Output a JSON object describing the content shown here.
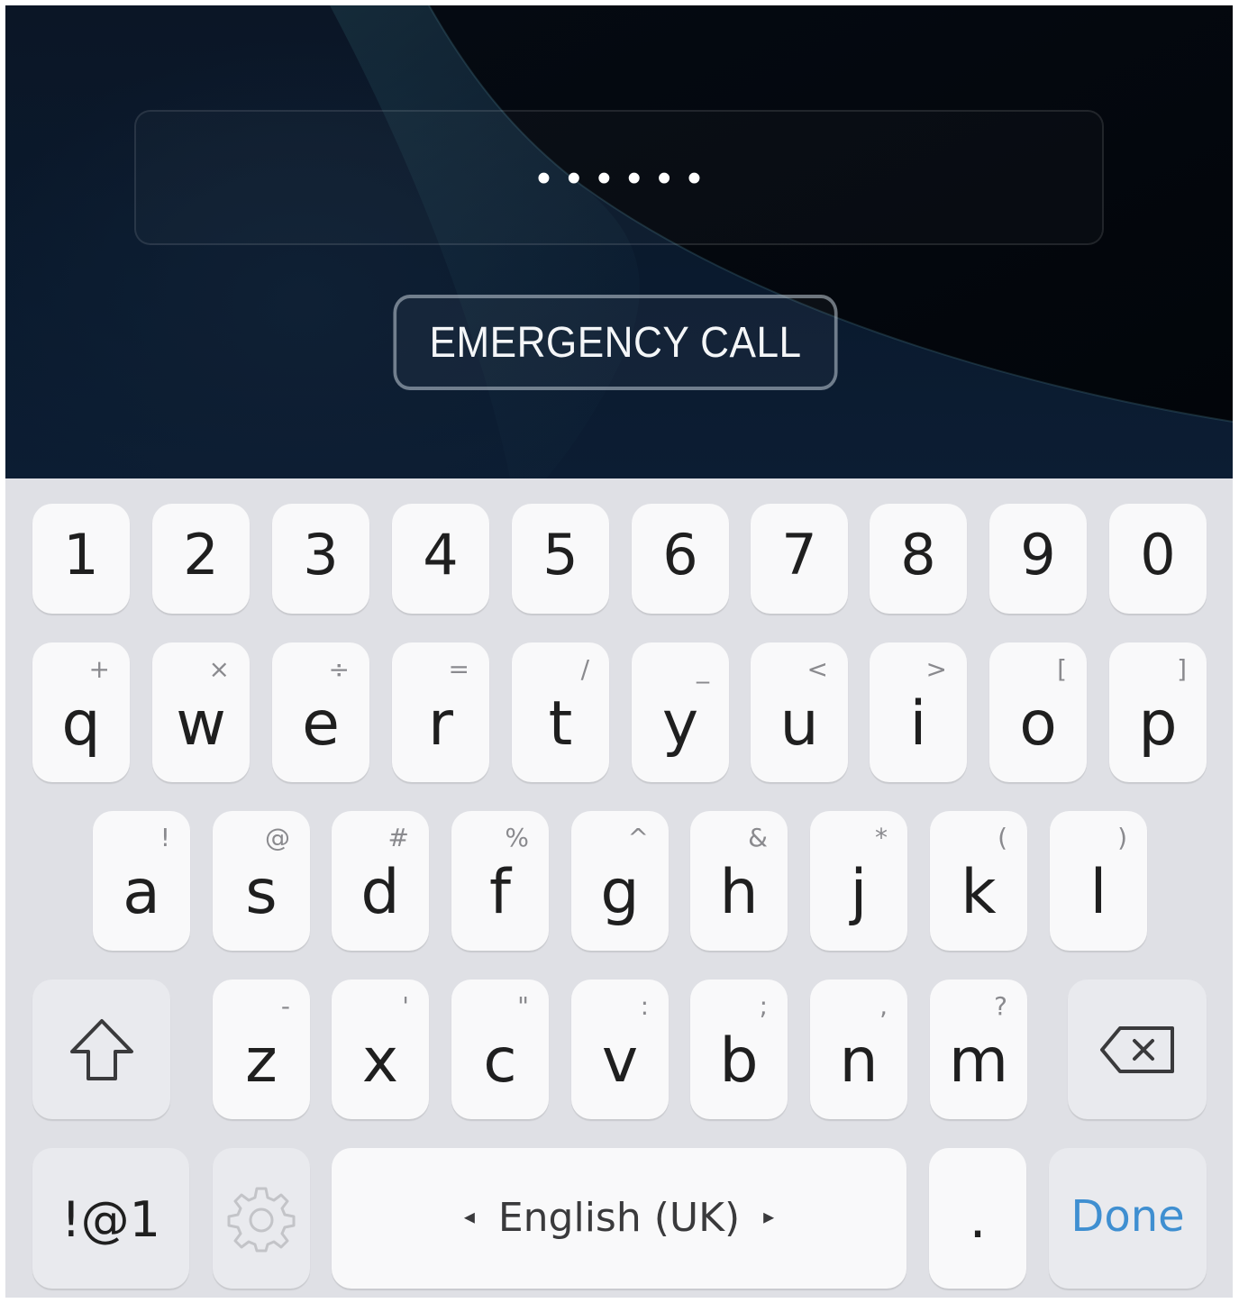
{
  "lock_screen": {
    "password_mask": "••••••",
    "emergency_label": "EMERGENCY CALL"
  },
  "keyboard": {
    "number_row": [
      "1",
      "2",
      "3",
      "4",
      "5",
      "6",
      "7",
      "8",
      "9",
      "0"
    ],
    "row1": [
      {
        "key": "q",
        "sub": "+"
      },
      {
        "key": "w",
        "sub": "×"
      },
      {
        "key": "e",
        "sub": "÷"
      },
      {
        "key": "r",
        "sub": "="
      },
      {
        "key": "t",
        "sub": "/"
      },
      {
        "key": "y",
        "sub": "_"
      },
      {
        "key": "u",
        "sub": "<"
      },
      {
        "key": "i",
        "sub": ">"
      },
      {
        "key": "o",
        "sub": "["
      },
      {
        "key": "p",
        "sub": "]"
      }
    ],
    "row2": [
      {
        "key": "a",
        "sub": "!"
      },
      {
        "key": "s",
        "sub": "@"
      },
      {
        "key": "d",
        "sub": "#"
      },
      {
        "key": "f",
        "sub": "%"
      },
      {
        "key": "g",
        "sub": "^"
      },
      {
        "key": "h",
        "sub": "&"
      },
      {
        "key": "j",
        "sub": "*"
      },
      {
        "key": "k",
        "sub": "("
      },
      {
        "key": "l",
        "sub": ")"
      }
    ],
    "row3": [
      {
        "key": "z",
        "sub": "-"
      },
      {
        "key": "x",
        "sub": "'"
      },
      {
        "key": "c",
        "sub": "\""
      },
      {
        "key": "v",
        "sub": ":"
      },
      {
        "key": "b",
        "sub": ";"
      },
      {
        "key": "n",
        "sub": ","
      },
      {
        "key": "m",
        "sub": "?"
      }
    ],
    "icons": {
      "shift": "shift-icon",
      "backspace": "backspace-icon",
      "settings": "gear-icon",
      "language_prev": "◂",
      "language_next": "▸"
    },
    "symbols_label": "!@1",
    "space_label": "English (UK)",
    "period_label": ".",
    "done_label": "Done",
    "done_color": "#3f8fd1"
  }
}
